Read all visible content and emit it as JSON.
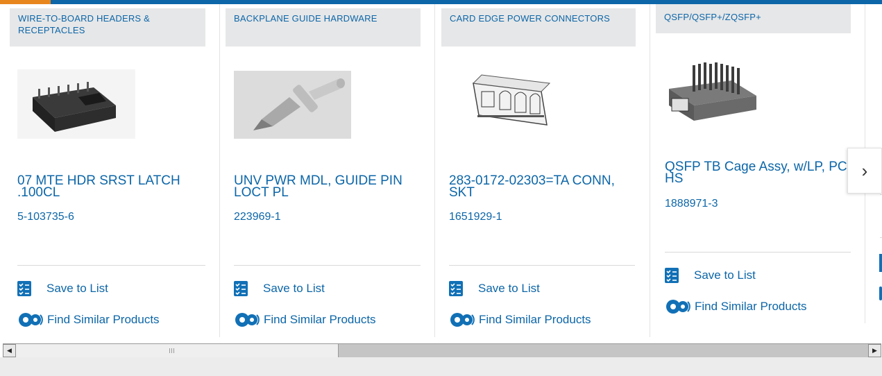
{
  "colors": {
    "brand_blue": "#0c66a8",
    "accent_orange": "#e8861e",
    "category_bg": "#e6e7e8"
  },
  "cards": [
    {
      "category": "WIRE-TO-BOARD HEADERS & RECEPTACLES",
      "title": "07 MTE HDR SRST LATCH .100CL",
      "part_number": "5-103735-6",
      "save_label": "Save to List",
      "similar_label": "Find Similar Products",
      "image_icon": "connector-header-image"
    },
    {
      "category": "BACKPLANE GUIDE HARDWARE",
      "title": "UNV PWR MDL, GUIDE PIN LOCT PL",
      "part_number": "223969-1",
      "save_label": "Save to List",
      "similar_label": "Find Similar Products",
      "image_icon": "guide-pin-image"
    },
    {
      "category": "CARD EDGE POWER CONNECTORS",
      "title": "283-0172-02303=TA CONN, SKT",
      "part_number": "1651929-1",
      "save_label": "Save to List",
      "similar_label": "Find Similar Products",
      "image_icon": "card-edge-connector-image"
    },
    {
      "category": "QSFP/QSFP+/ZQSFP+",
      "title": "QSFP TB Cage Assy, w/LP, PCI HS",
      "part_number": "1888971-3",
      "save_label": "Save to List",
      "similar_label": "Find Similar Products",
      "image_icon": "qsfp-cage-image"
    }
  ],
  "carousel": {
    "next_icon": "chevron-right-icon",
    "next_glyph": "›"
  },
  "scrollbar": {
    "left_arrow": "◀",
    "right_arrow": "▶"
  }
}
